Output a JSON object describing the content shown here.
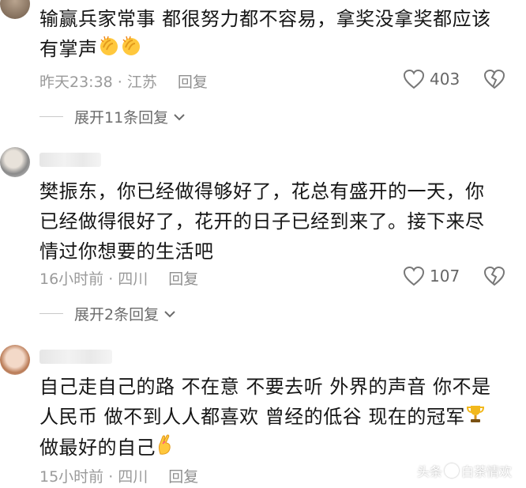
{
  "comments": [
    {
      "text": "输赢兵家常事 都很努力都不容易，拿奖没拿奖都应该有掌声",
      "emojis": [
        "clapping-hands-icon",
        "clapping-hands-icon"
      ],
      "time_location": "昨天23:38 · 江苏",
      "reply_label": "回复",
      "likes": "403",
      "expand_label": "展开11条回复"
    },
    {
      "text": "樊振东，你已经做得够好了，花总有盛开的一天，你已经做得很好了，花开的日子已经到来了。接下来尽情过你想要的生活吧",
      "time_location": "16小时前 · 四川",
      "reply_label": "回复",
      "likes": "107",
      "expand_label": "展开2条回复"
    },
    {
      "text": "自己走自己的路 不在意 不要去听 外界的声音 你不是人民币 做不到人人都喜欢 曾经的低谷 现在的冠军",
      "trophy": "trophy-icon",
      "text_tail": " 做最好的自己",
      "emoji_tail": "crossed-fingers-icon",
      "time_location": "15小时前 · 四川",
      "reply_label": "回复"
    }
  ],
  "watermark": {
    "prefix": "头条",
    "handle": "白茶情欢"
  },
  "colors": {
    "text": "#161616",
    "meta": "#9a9a9a",
    "icon": "#777777"
  }
}
